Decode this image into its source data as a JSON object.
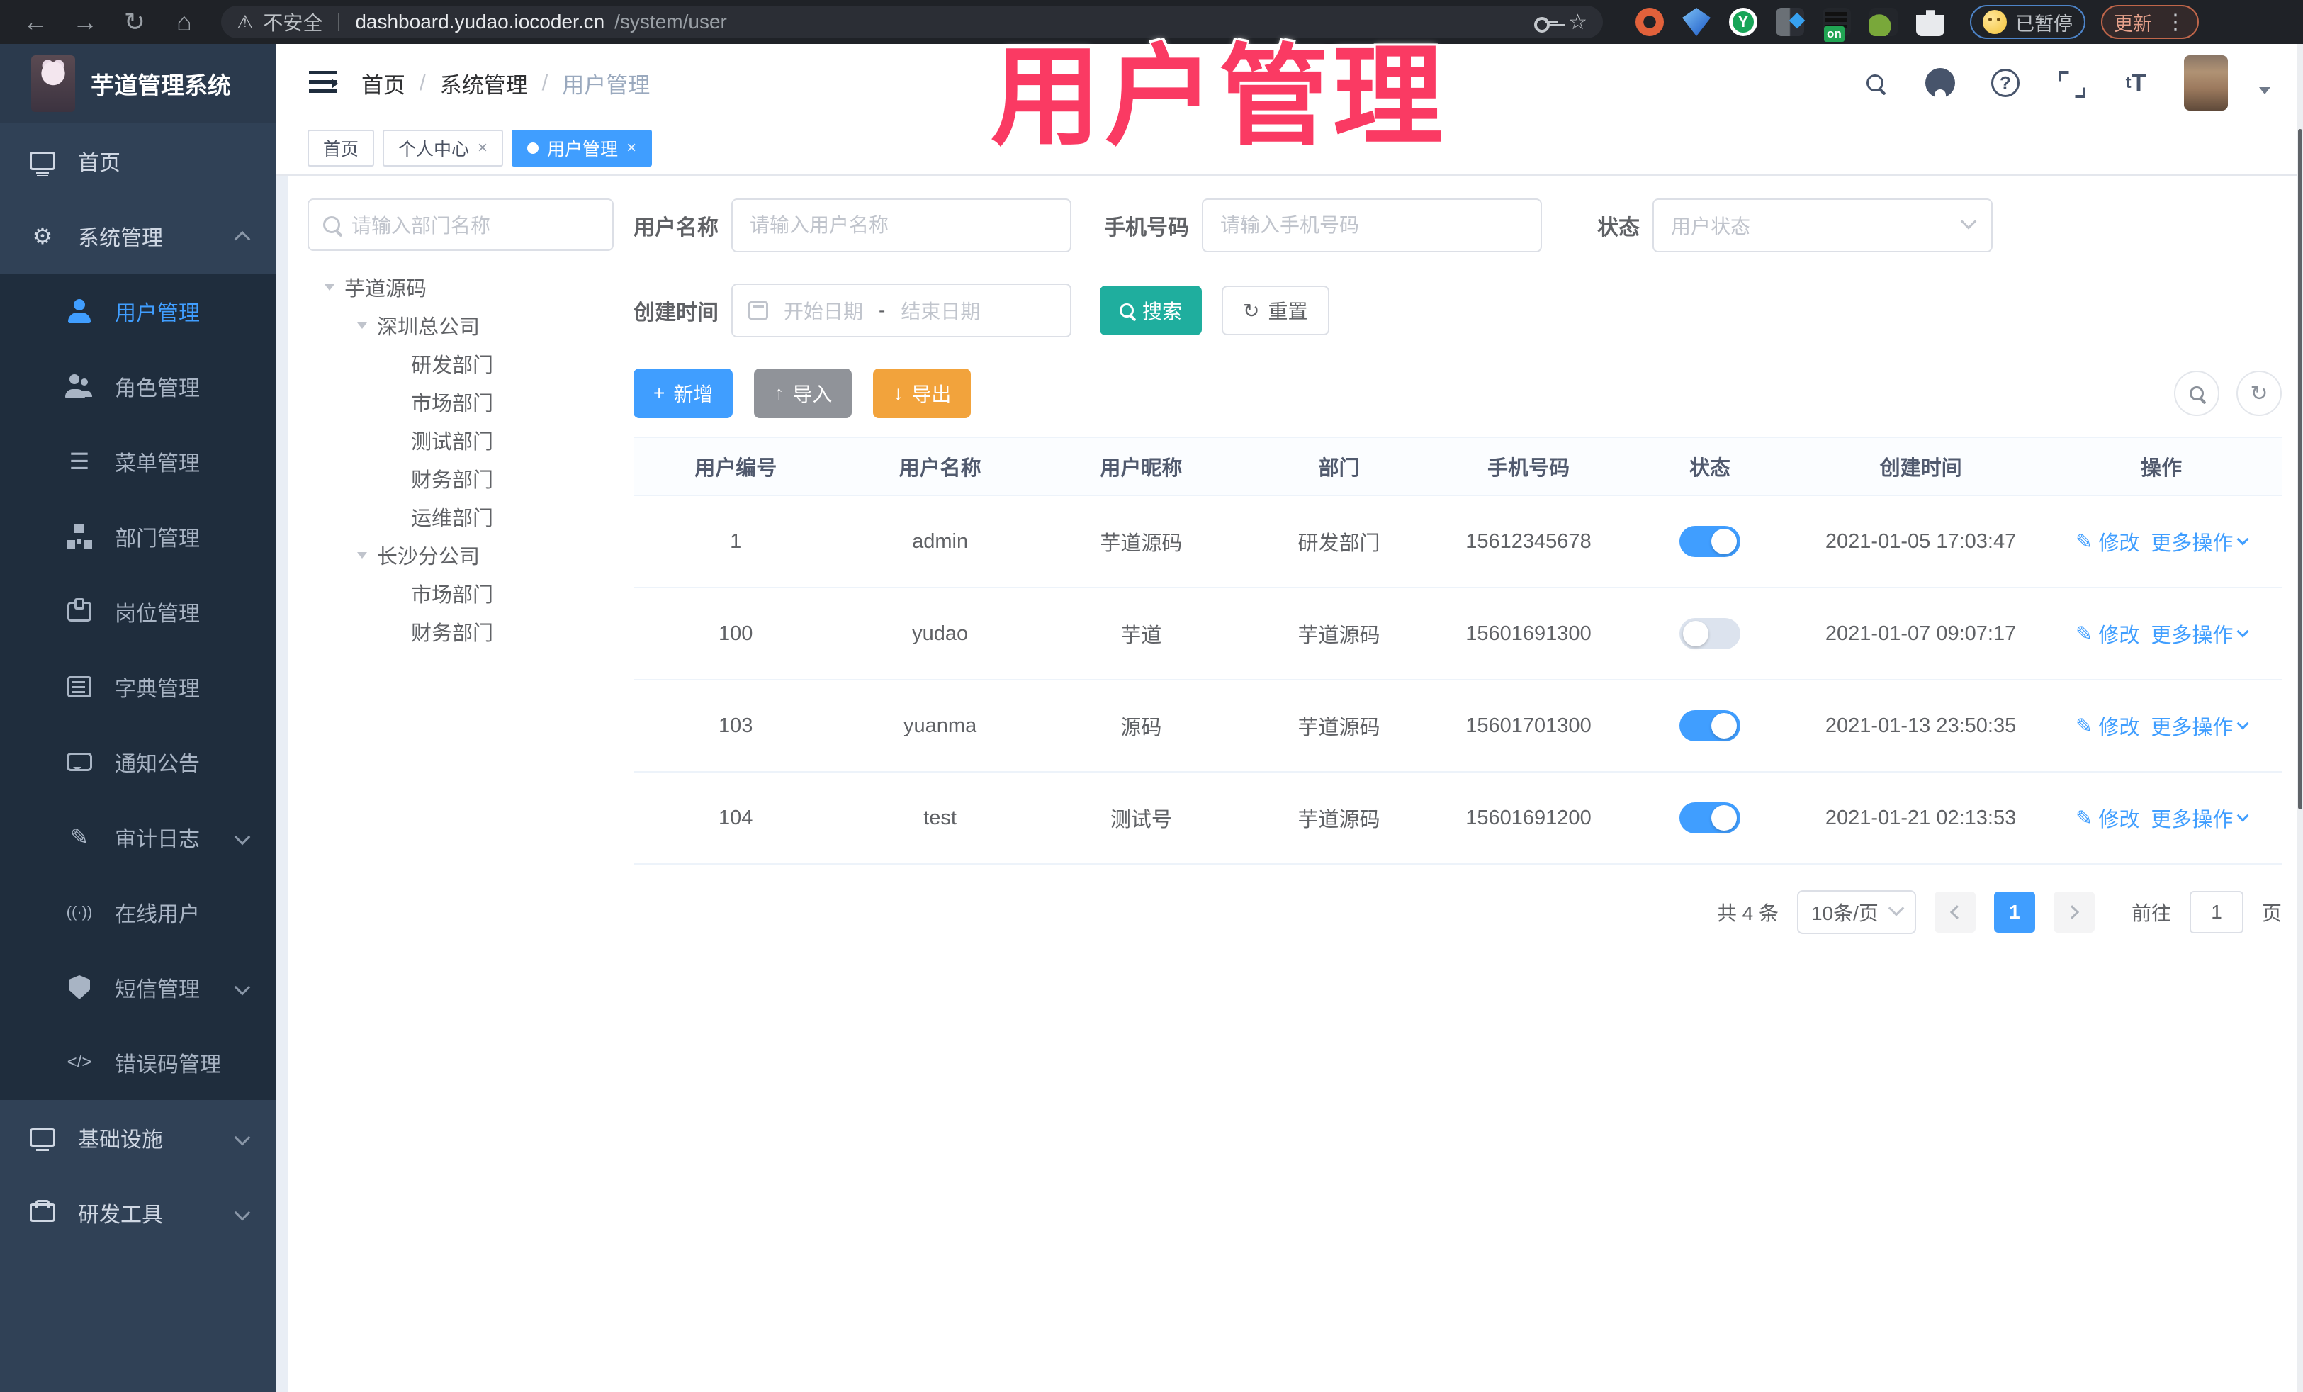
{
  "browser": {
    "security_label": "不安全",
    "url_host": "dashboard.yudao.iocoder.cn",
    "url_path": "/system/user",
    "extension_badge": "on",
    "profile_status": "已暂停",
    "update_label": "更新"
  },
  "annotation": {
    "text": "用户管理",
    "color": "#fa3a63"
  },
  "app_header": {
    "logo_title": "芋道管理系统",
    "breadcrumb": [
      "首页",
      "系统管理",
      "用户管理"
    ],
    "font_icon_label": "tT"
  },
  "tabs": [
    {
      "label": "首页"
    },
    {
      "label": "个人中心",
      "close": "×"
    },
    {
      "label": "用户管理",
      "close": "×"
    }
  ],
  "sidebar": {
    "items": [
      {
        "label": "首页"
      },
      {
        "label": "系统管理"
      },
      {
        "label": "用户管理"
      },
      {
        "label": "角色管理"
      },
      {
        "label": "菜单管理"
      },
      {
        "label": "部门管理"
      },
      {
        "label": "岗位管理"
      },
      {
        "label": "字典管理"
      },
      {
        "label": "通知公告"
      },
      {
        "label": "审计日志"
      },
      {
        "label": "在线用户"
      },
      {
        "label": "短信管理"
      },
      {
        "label": "错误码管理"
      },
      {
        "label": "基础设施"
      },
      {
        "label": "研发工具"
      }
    ],
    "online_icon_text": "((·))",
    "errcode_icon_text": "</>"
  },
  "dept_panel": {
    "search_placeholder": "请输入部门名称",
    "tree": [
      {
        "label": "芋道源码"
      },
      {
        "label": "深圳总公司"
      },
      {
        "label": "研发部门"
      },
      {
        "label": "市场部门"
      },
      {
        "label": "测试部门"
      },
      {
        "label": "财务部门"
      },
      {
        "label": "运维部门"
      },
      {
        "label": "长沙分公司"
      },
      {
        "label": "市场部门"
      },
      {
        "label": "财务部门"
      }
    ]
  },
  "filters": {
    "username_label": "用户名称",
    "username_placeholder": "请输入用户名称",
    "mobile_label": "手机号码",
    "mobile_placeholder": "请输入手机号码",
    "status_label": "状态",
    "status_placeholder": "用户状态",
    "create_time_label": "创建时间",
    "date_start_placeholder": "开始日期",
    "date_separator": "-",
    "date_end_placeholder": "结束日期",
    "search_button": "搜索",
    "reset_button": "重置"
  },
  "toolbar": {
    "add_label": "新增",
    "import_label": "导入",
    "export_label": "导出",
    "add_sign": "+",
    "import_sign": "↑",
    "export_sign": "↓"
  },
  "table": {
    "columns": [
      "用户编号",
      "用户名称",
      "用户昵称",
      "部门",
      "手机号码",
      "状态",
      "创建时间",
      "操作"
    ],
    "rows": [
      {
        "id": "1",
        "username": "admin",
        "nickname": "芋道源码",
        "dept": "研发部门",
        "mobile": "15612345678",
        "status": true,
        "created": "2021-01-05 17:03:47"
      },
      {
        "id": "100",
        "username": "yudao",
        "nickname": "芋道",
        "dept": "芋道源码",
        "mobile": "15601691300",
        "status": false,
        "created": "2021-01-07 09:07:17"
      },
      {
        "id": "103",
        "username": "yuanma",
        "nickname": "源码",
        "dept": "芋道源码",
        "mobile": "15601701300",
        "status": true,
        "created": "2021-01-13 23:50:35"
      },
      {
        "id": "104",
        "username": "test",
        "nickname": "测试号",
        "dept": "芋道源码",
        "mobile": "15601691200",
        "status": true,
        "created": "2021-01-21 02:13:53"
      }
    ],
    "actions": {
      "edit": "修改",
      "more": "更多操作",
      "edit_icon": "✎"
    }
  },
  "pagination": {
    "total_text": "共 4 条",
    "page_size": "10条/页",
    "current_page": "1",
    "goto_label": "前往",
    "goto_value": "1",
    "page_unit": "页"
  }
}
